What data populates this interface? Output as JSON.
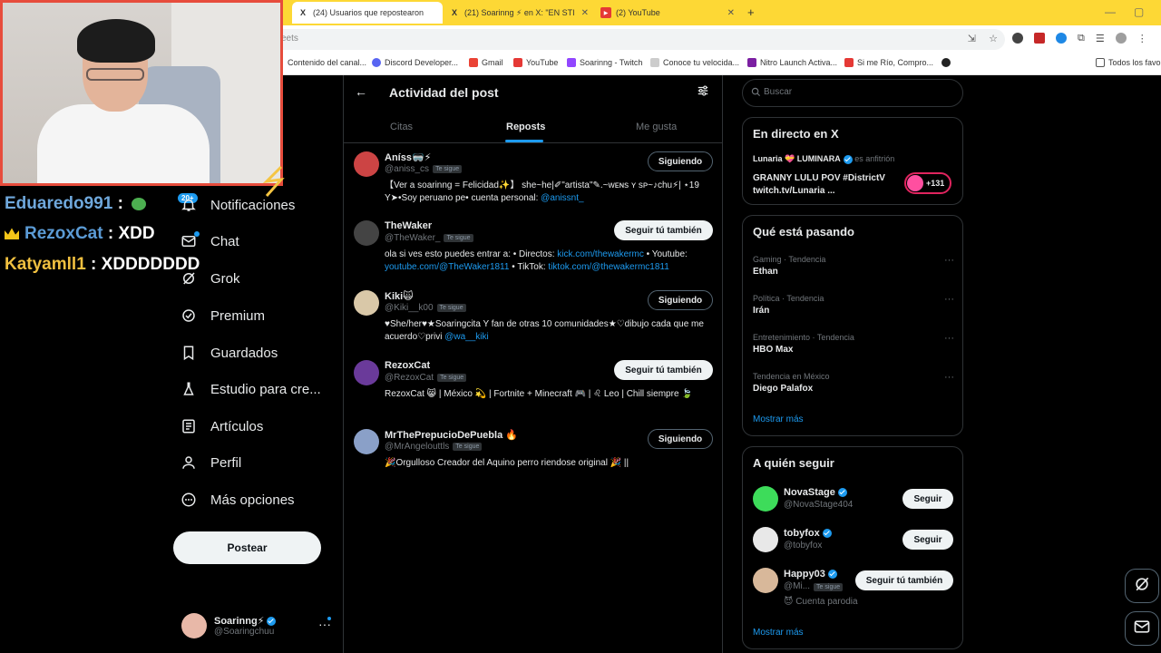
{
  "browser": {
    "tabs": [
      {
        "label": "(24) Usuarios que repostearon",
        "icon": "X"
      },
      {
        "label": "(21) Soarinng ⚡ en X: \"EN STI",
        "icon": "X"
      },
      {
        "label": "(2) YouTube",
        "icon": "▶"
      }
    ],
    "new_tab": "+",
    "omnibox_text": "eets",
    "bookmarks": [
      {
        "label": "Contenido del canal..."
      },
      {
        "label": "Discord Developer..."
      },
      {
        "label": "Gmail"
      },
      {
        "label": "YouTube"
      },
      {
        "label": "Soarinng - Twitch"
      },
      {
        "label": "Conoce tu velocida..."
      },
      {
        "label": "Nitro Launch Activa..."
      },
      {
        "label": "Si me Río, Compro..."
      },
      {
        "label": "Todos los favor"
      }
    ]
  },
  "chat": [
    {
      "user": "Eduaredo991",
      "sep": " : ",
      "msg": ""
    },
    {
      "user": "RezoxCat",
      "sep": " : ",
      "msg": "XDD"
    },
    {
      "user": "Katyamll1",
      "sep": " : ",
      "msg": "XDDDDDDD"
    }
  ],
  "nav": {
    "badge": "20+",
    "items": [
      {
        "label": "Notificaciones",
        "icon": "bell-icon"
      },
      {
        "label": "Chat",
        "icon": "mail-icon"
      },
      {
        "label": "Grok",
        "icon": "grok-icon"
      },
      {
        "label": "Premium",
        "icon": "premium-icon"
      },
      {
        "label": "Guardados",
        "icon": "bookmark-icon"
      },
      {
        "label": "Estudio para cre...",
        "icon": "flask-icon"
      },
      {
        "label": "Artículos",
        "icon": "article-icon"
      },
      {
        "label": "Perfil",
        "icon": "person-icon"
      },
      {
        "label": "Más opciones",
        "icon": "more-circle-icon"
      }
    ],
    "post_label": "Postear",
    "profile": {
      "name": "Soarinng⚡",
      "handle": "@Soaringchuu",
      "more": "···"
    }
  },
  "center": {
    "title": "Actividad del post",
    "back": "←",
    "tabs": [
      "Citas",
      "Reposts",
      "Me gusta"
    ],
    "active_tab": "Reposts",
    "rows": [
      {
        "name": "Aníss🥽⚡",
        "handle": "@aniss_cs",
        "tesigue": "Te sigue",
        "button": "Siguiendo",
        "button_type": "following",
        "bio": [
          {
            "t": "【Ver a soarinng = Felicidad✨】 she~he|✐\"artista\"✎.~ᴡᴇɴs ʏ sᴘ~♪chu⚡| ⋆19 Y➤•Soy peruano pe• cuenta personal: "
          },
          {
            "t": "@anissnt_",
            "link": true
          }
        ],
        "color": "#c44"
      },
      {
        "name": "TheWaker",
        "handle": "@TheWaker_",
        "tesigue": "Te sigue",
        "button": "Seguir tú también",
        "button_type": "follow",
        "bio": [
          {
            "t": "ola si ves esto puedes entrar a: • Directos: "
          },
          {
            "t": "kick.com/thewakermc",
            "link": true
          },
          {
            "t": " • Youtube: "
          },
          {
            "t": "youtube.com/@TheWaker1811",
            "link": true
          },
          {
            "t": " • TikTok: "
          },
          {
            "t": "tiktok.com/@thewakermc1811",
            "link": true
          }
        ],
        "color": "#444"
      },
      {
        "name": "Kiki🙀",
        "handle": "@Kiki__k00",
        "tesigue": "Te sigue",
        "button": "Siguiendo",
        "button_type": "following",
        "bio": [
          {
            "t": "♥She/her♥★Soaringcita Y fan de otras 10 comunidades★♡dibujo cada que me acuerdo♡privi "
          },
          {
            "t": "@wa__kiki",
            "link": true
          }
        ],
        "color": "#d9c8a8"
      },
      {
        "name": "RezoxCat",
        "handle": "@RezoxCat",
        "tesigue": "Te sigue",
        "button": "Seguir tú también",
        "button_type": "follow",
        "bio": [
          {
            "t": "RezoxCat 😸 | México 💫 | Fortnite + Minecraft 🎮 | ♌ Leo | Chill siempre 🍃"
          }
        ],
        "color": "#6a3a9a"
      },
      {
        "name": "MrThePrepucioDePuebla 🔥",
        "handle": "@MrAngelouttls",
        "tesigue": "Te sigue",
        "button": "Siguiendo",
        "button_type": "following",
        "bio": [
          {
            "t": "🎉Orgulloso Creador del Aquino perro riendose original 🎉 ||"
          }
        ],
        "color": "#8aa0c8"
      }
    ]
  },
  "right": {
    "search_placeholder": "Buscar",
    "live": {
      "title": "En directo en X",
      "host_name": "Lunaria 💝 LUMINARA",
      "host_role": " es anfitrión",
      "stream_title": "GRANNY LULU POV #DistrictV twitch.tv/Lunaria ...",
      "count": "+131"
    },
    "trends": {
      "title": "Qué está pasando",
      "items": [
        {
          "category": "Gaming · Tendencia",
          "name": "Ethan"
        },
        {
          "category": "Política · Tendencia",
          "name": "Irán"
        },
        {
          "category": "Entretenimiento · Tendencia",
          "name": "HBO Max"
        },
        {
          "category": "Tendencia en México",
          "name": "Diego Palafox"
        }
      ],
      "more": "Mostrar más",
      "more_icon": "···"
    },
    "who_to_follow": {
      "title": "A quién seguir",
      "items": [
        {
          "name": "NovaStage",
          "handle": "@NovaStage404",
          "button": "Seguir",
          "color": "#3ddc5a"
        },
        {
          "name": "tobyfox",
          "handle": "@tobyfox",
          "button": "Seguir",
          "color": "#e8e8e8"
        },
        {
          "name": "Happy03",
          "handle": "@Mi...",
          "tesigue": "Te sigue",
          "extra": "😈 Cuenta parodia",
          "button": "Seguir tú también",
          "color": "#d8b89a"
        }
      ],
      "more": "Mostrar más"
    }
  },
  "colors": {
    "accent": "#1d9bf0",
    "tabbar": "#fdd835",
    "webcam_border": "#e74c3c"
  }
}
